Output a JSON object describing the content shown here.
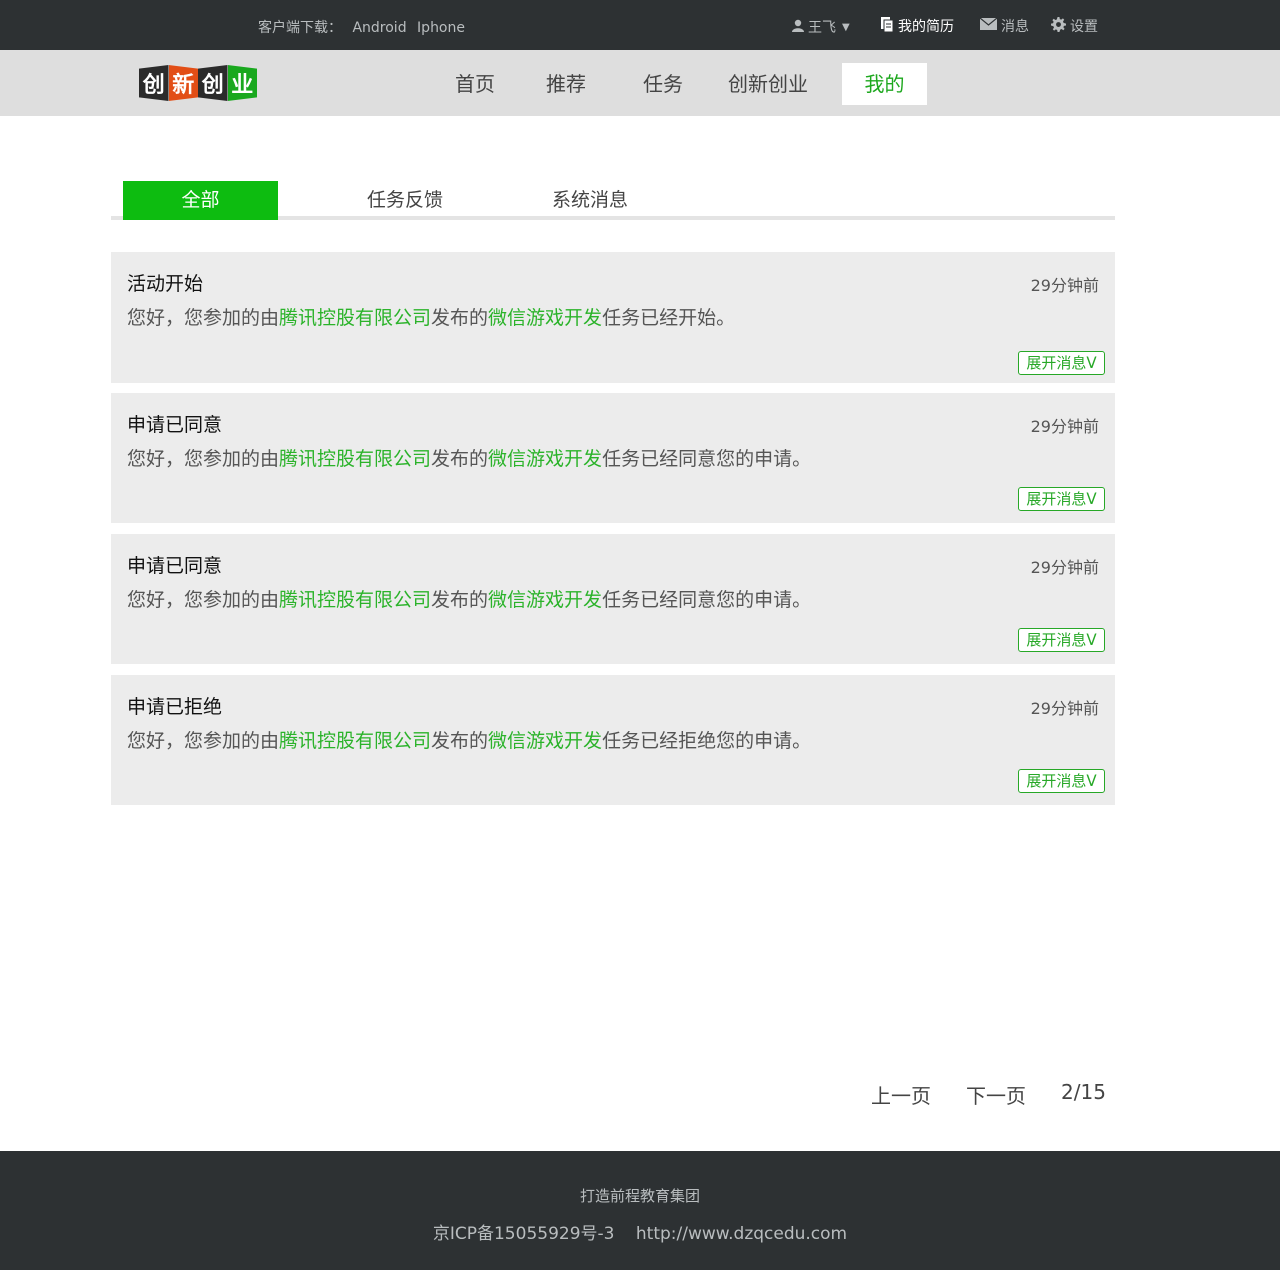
{
  "topbar": {
    "download_label": "客户端下载：",
    "android": "Android",
    "iphone": "Iphone",
    "user_name": "王飞",
    "caret": "▼",
    "resume": "我的简历",
    "messages": "消息",
    "settings": "设置"
  },
  "nav": {
    "logo_chars": [
      "创",
      "新",
      "创",
      "业"
    ],
    "items": [
      "首页",
      "推荐",
      "任务",
      "创新创业",
      "我的"
    ],
    "active": "我的"
  },
  "tabs": {
    "items": [
      "全部",
      "任务反馈",
      "系统消息"
    ],
    "active": "全部"
  },
  "messages": [
    {
      "title": "活动开始",
      "time": "29分钟前",
      "prefix": "您好，您参加的由",
      "company": "腾讯控股有限公司",
      "mid": "发布的",
      "task": "微信游戏开发",
      "suffix": "任务已经开始。",
      "expand": "展开消息ᐯ"
    },
    {
      "title": "申请已同意",
      "time": "29分钟前",
      "prefix": "您好，您参加的由",
      "company": "腾讯控股有限公司",
      "mid": "发布的",
      "task": "微信游戏开发",
      "suffix": "任务已经同意您的申请。",
      "expand": "展开消息ᐯ"
    },
    {
      "title": "申请已同意",
      "time": "29分钟前",
      "prefix": "您好，您参加的由",
      "company": "腾讯控股有限公司",
      "mid": "发布的",
      "task": "微信游戏开发",
      "suffix": "任务已经同意您的申请。",
      "expand": "展开消息ᐯ"
    },
    {
      "title": "申请已拒绝",
      "time": "29分钟前",
      "prefix": "您好，您参加的由",
      "company": "腾讯控股有限公司",
      "mid": "发布的",
      "task": "微信游戏开发",
      "suffix": "任务已经拒绝您的申请。",
      "expand": "展开消息ᐯ"
    }
  ],
  "pagination": {
    "prev": "上一页",
    "next": "下一页",
    "page_info": "2/15"
  },
  "footer": {
    "slogan": "打造前程教育集团",
    "icp": "京ICP备15055929号-3",
    "url": "http://www.dzqcedu.com"
  },
  "colors": {
    "accent_green": "#0dbc10",
    "link_green": "#2bb32a",
    "dark_bar": "#2d3133",
    "nav_bg": "#dedede",
    "card_bg": "#ececec"
  }
}
